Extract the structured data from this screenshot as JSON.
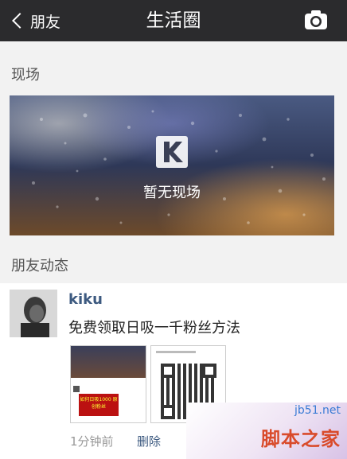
{
  "nav": {
    "back_label": "朋友",
    "title": "生活圈"
  },
  "live": {
    "section_label": "现场",
    "empty_text": "暂无现场"
  },
  "feed": {
    "section_label": "朋友动态",
    "post": {
      "username": "kiku",
      "text": "免费领取日吸一千粉丝方法",
      "time": "1分钟前",
      "delete_label": "删除",
      "thumb1": {
        "caption": "如何日吸1000\n原创粉丝"
      }
    }
  },
  "watermark": {
    "url": "jb51.net",
    "name": "脚本之家"
  },
  "colors": {
    "nav_bg": "#2b2b2d",
    "link": "#3d5a80",
    "page_bg": "#f2f2f2"
  }
}
